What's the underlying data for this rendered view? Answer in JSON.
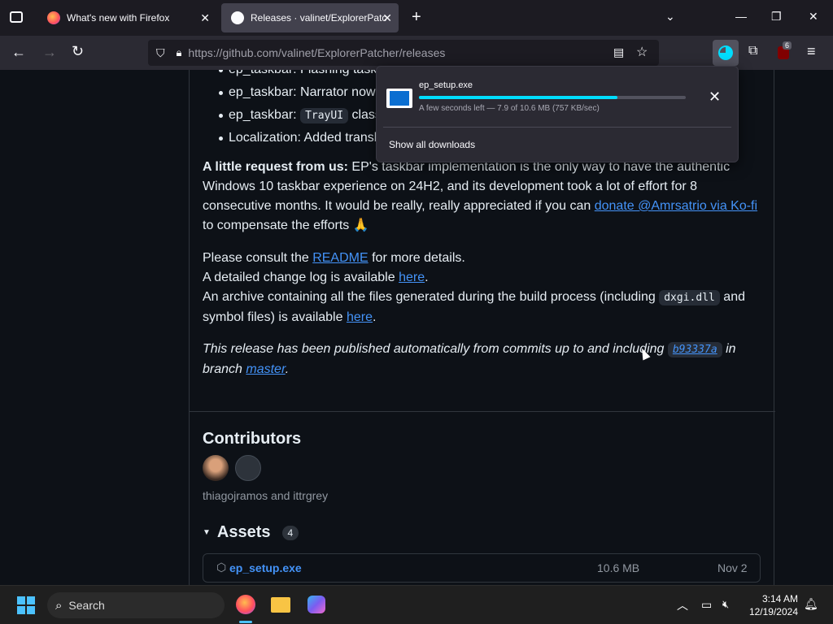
{
  "tabs": [
    {
      "title": "What's new with Firefox"
    },
    {
      "title": "Releases · valinet/ExplorerPatch"
    }
  ],
  "urlbar": {
    "url_prefix": "https://github.com/",
    "url_rest": "valinet/ExplorerPatcher/releases"
  },
  "toolbar": {
    "extensions_badge": "6"
  },
  "download": {
    "filename": "ep_setup.exe",
    "status": "A few seconds left — 7.9 of 10.6 MB (757 KB/sec)",
    "progress": 0.745,
    "show_all": "Show all downloads"
  },
  "notes": {
    "bullets": [
      {
        "text": "ep_taskbar: Flashing taskb"
      },
      {
        "text": "ep_taskbar: Narrator now"
      },
      {
        "pre": "ep_taskbar: ",
        "code": "TrayUI",
        "post": " class"
      },
      {
        "text": "Localization: Added transl"
      }
    ],
    "request_bold": "A little request from us:",
    "request_line1": " EP's taskbar implementation is the only way to have the authentic",
    "request_line2": "Windows 10 taskbar experience on 24H2, and its development took a lot of effort for 8",
    "request_line3": "consecutive months. It would be really, really appreciated if you can ",
    "request_link": "donate @Amrsatrio via Ko-fi",
    "request_line4": "to compensate the efforts 🙏",
    "consult_pre": "Please consult the ",
    "consult_link": "README",
    "consult_post": " for more details.",
    "changelog_pre": "A detailed change log is available ",
    "changelog_link": "here",
    "changelog_post": ".",
    "archive_pre": "An archive containing all the files generated during the build process (including ",
    "archive_code": "dxgi.dll",
    "archive_post": " and",
    "archive_line2_pre": "symbol files) is available ",
    "archive_link": "here",
    "archive_line2_post": ".",
    "published_pre": "This release has been published automatically from commits up to and including ",
    "published_commit": "b93337a",
    "published_post": " in",
    "published_line2_pre": "branch ",
    "published_branch": "master",
    "published_line2_post": "."
  },
  "contributors": {
    "title": "Contributors",
    "names": "thiagojramos and ittrgrey"
  },
  "assets": {
    "title": "Assets",
    "count": "4",
    "items": [
      {
        "name": "ep_setup.exe",
        "size": "10.6 MB",
        "date": "Nov 2"
      }
    ]
  },
  "taskbar": {
    "search_label": "Search",
    "time": "3:14 AM",
    "date": "12/19/2024"
  }
}
